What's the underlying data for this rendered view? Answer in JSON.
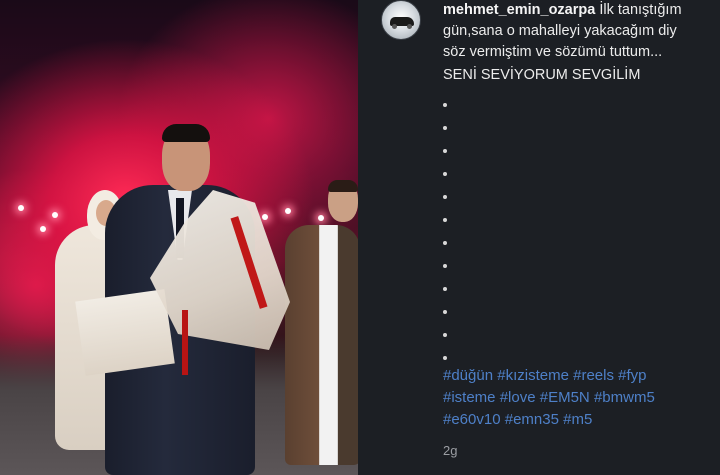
{
  "post": {
    "username": "mehmet_emin_ozarpa",
    "caption_lines": [
      "İlk tanıştığım",
      "gün,sana o mahalleyi yakacağım diy",
      "söz vermiştim ve sözümü tuttum..."
    ],
    "headline": "SENİ SEVİYORUM SEVGİLİM",
    "dot_separator_count": 12,
    "hashtags": [
      [
        "#düğün",
        "#kızisteme",
        "#reels",
        "#fyp"
      ],
      [
        "#isteme",
        "#love",
        "#EM5N",
        "#bmwm5"
      ],
      [
        "#e60v10",
        "#emn35",
        "#m5"
      ]
    ],
    "timestamp": "2g"
  },
  "photo": {
    "description_icon": "wedding-flare-photo"
  },
  "colors": {
    "panel_bg": "#1c1f24",
    "hashtag": "#4e80c8",
    "text": "#ececec",
    "muted": "#9b9ea3"
  }
}
